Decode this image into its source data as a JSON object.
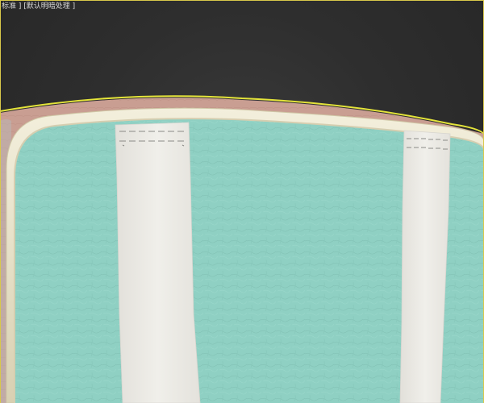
{
  "viewport": {
    "label": "标准 ] [默认明暗处理 ]"
  },
  "scene": {
    "object": "cushion",
    "colors": {
      "selection_outline": "#e4e43a",
      "backing": "#c99e92",
      "piping": "#e8e2c8",
      "leather": "#8fd0c3",
      "strap": "#ebe9e3",
      "stitch": "#8a8a86",
      "background": "#2e2e2e"
    }
  }
}
